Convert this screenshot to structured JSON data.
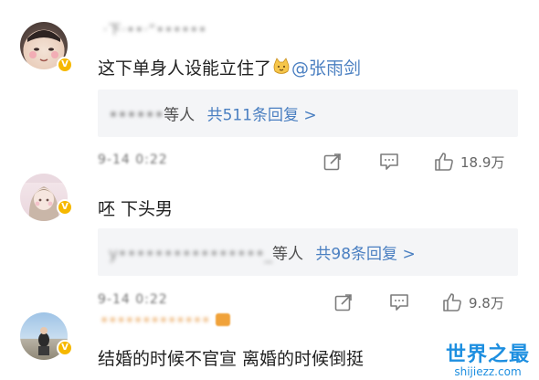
{
  "comments": [
    {
      "username": "·下·••·“••••••",
      "content": "这下单身人设能立住了",
      "emoji": "cat-face-emoji",
      "mention": "@张雨剑",
      "reply_users": "••••••",
      "reply_others": "等人",
      "reply_count": "共511条回复 >"
    },
    {
      "timestamp": "9-14 0:22",
      "share_icon": "share-icon",
      "comment_icon": "comment-icon",
      "like_icon": "thumbs-up-icon",
      "like_count": "18.9万",
      "content": "呸 下头男",
      "reply_users": "y••••••••••••••••_",
      "reply_others": "等人",
      "reply_count": "共98条回复 >"
    },
    {
      "timestamp": "9-14 0:22",
      "like_count": "9.8万",
      "username": "•••••••••••••",
      "content": "结婚的时候不官宣 离婚的时候倒挺"
    }
  ],
  "watermark": {
    "title": "世界之最",
    "url": "shijiezz.com"
  },
  "colors": {
    "link_blue": "#4a7fc1",
    "reply_bg": "#f4f5f7",
    "vip_badge": "#f6b800"
  }
}
